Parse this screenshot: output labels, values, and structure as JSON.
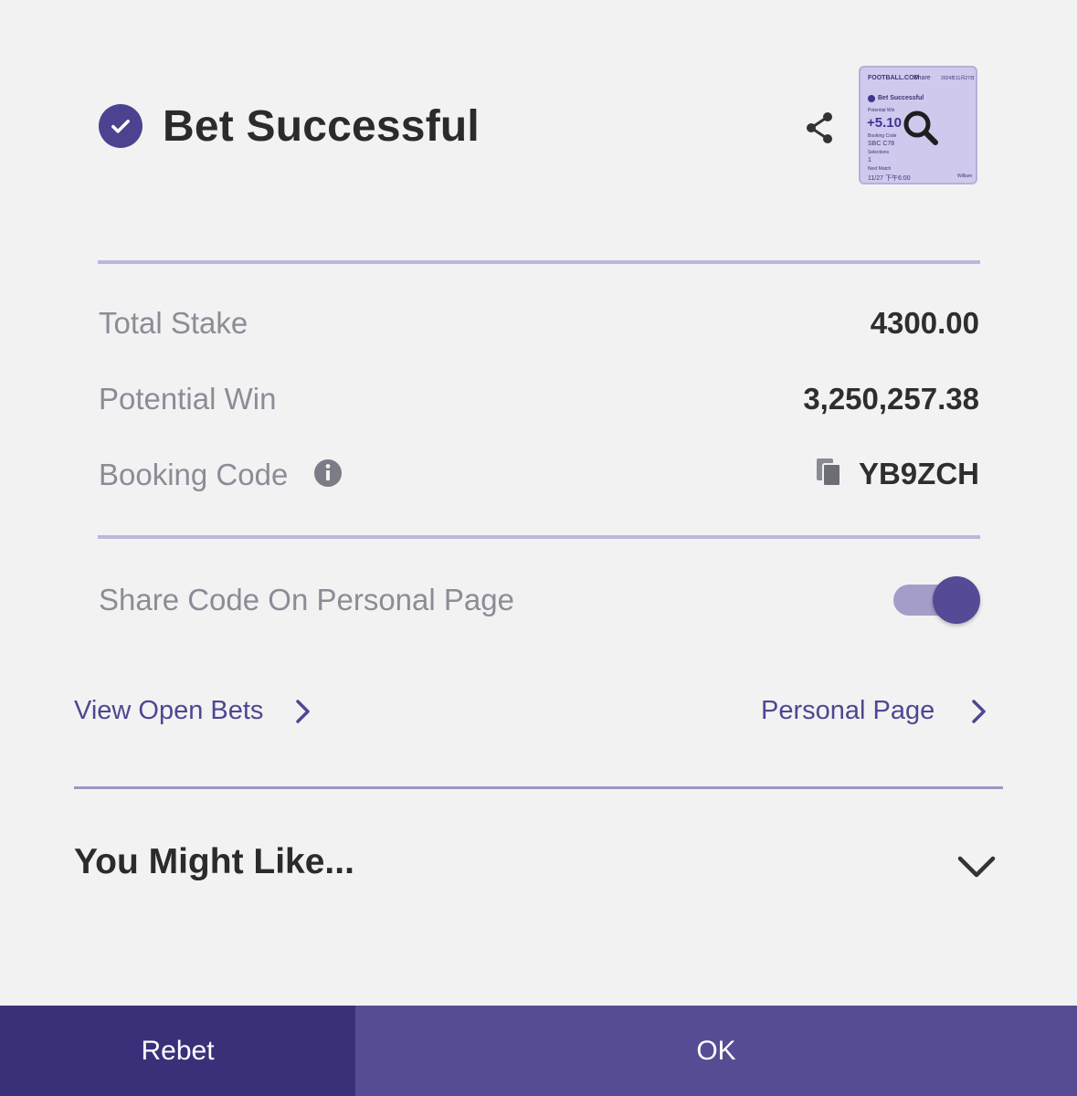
{
  "header": {
    "title": "Bet Successful",
    "check_icon": "check-circle-icon",
    "share_icon": "share-icon",
    "thumbnail": {
      "brand": "FOOTBALL.COM",
      "share_label": "Share",
      "date": "2024年11月27日",
      "title": "Bet Successful",
      "potential_win_label": "Potential Win",
      "amount": "+5.10",
      "booking_code_label": "Booking Code",
      "booking_code": "SBC C78",
      "selections_label": "Selections",
      "selections": "1",
      "next_match_label": "Next Match",
      "next_match": "11/27 下午6:00",
      "user": "William",
      "zoom_icon": "magnifier-icon"
    }
  },
  "details": {
    "total_stake_label": "Total Stake",
    "total_stake_value": "4300.00",
    "potential_win_label": "Potential Win",
    "potential_win_value": "3,250,257.38",
    "booking_code_label": "Booking Code",
    "booking_code_value": "YB9ZCH"
  },
  "share_toggle": {
    "label": "Share Code On Personal Page",
    "enabled": true
  },
  "links": {
    "view_open_bets": "View Open Bets",
    "personal_page": "Personal Page"
  },
  "you_might_like": {
    "title": "You Might Like..."
  },
  "footer": {
    "rebet_label": "Rebet",
    "ok_label": "OK"
  },
  "colors": {
    "accent": "#4b438f",
    "rebet_bg": "#383079",
    "ok_bg": "#554c93",
    "divider": "#bcb6de"
  }
}
